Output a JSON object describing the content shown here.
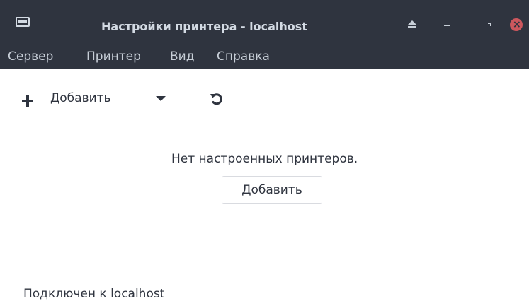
{
  "window": {
    "title": "Настройки принтера - localhost"
  },
  "menubar": {
    "items": [
      {
        "label": "Сервер"
      },
      {
        "label": "Принтер"
      },
      {
        "label": "Вид"
      },
      {
        "label": "Справка"
      }
    ]
  },
  "toolbar": {
    "add_label": "Добавить"
  },
  "main": {
    "empty_message": "Нет настроенных принтеров.",
    "add_button_label": "Добавить"
  },
  "statusbar": {
    "text": "Подключен к localhost"
  },
  "icons": {
    "app": "printer-app-icon",
    "eject": "eject-icon",
    "minimize": "minimize-icon",
    "maximize": "maximize-icon",
    "close": "close-icon",
    "add": "plus-icon",
    "dropdown": "chevron-down-icon",
    "refresh": "refresh-icon"
  },
  "colors": {
    "titlebar_bg": "#2f343f",
    "title_text": "#d3dae3",
    "close_button": "#cc575d",
    "content_bg": "#ffffff",
    "text": "#2f343f"
  }
}
